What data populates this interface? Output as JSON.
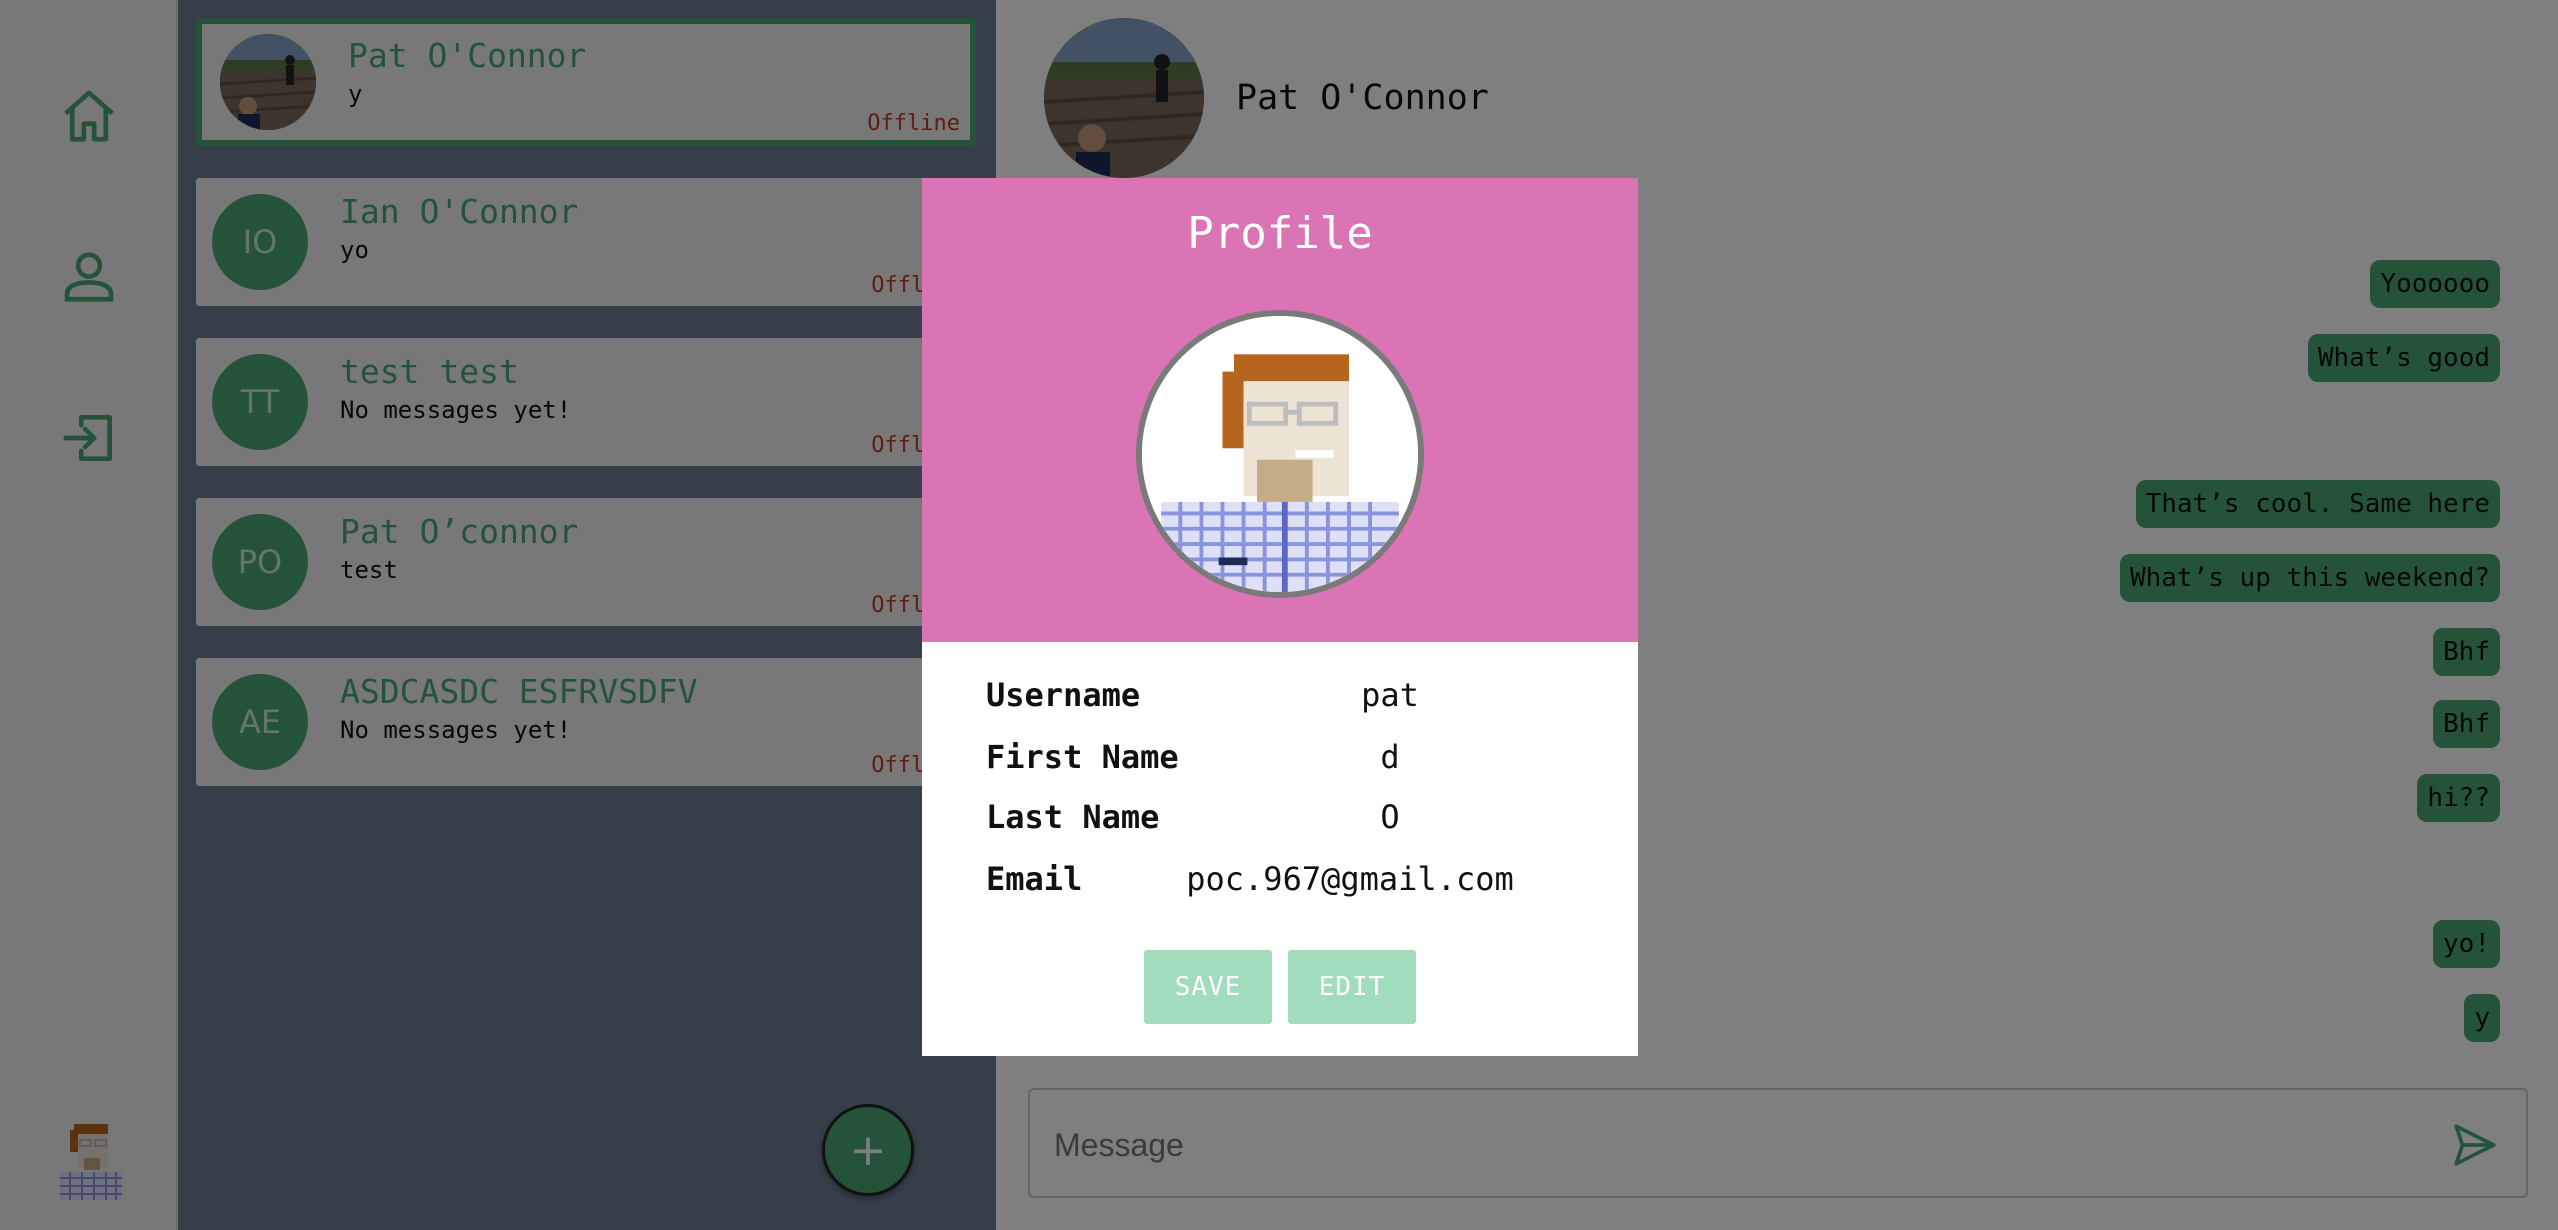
{
  "app": {
    "accent": "#4aa672",
    "panel_bg": "#6c7d92",
    "profile_header": "#db74b4"
  },
  "rail": {
    "items": [
      {
        "icon": "home-icon"
      },
      {
        "icon": "user-icon"
      },
      {
        "icon": "logout-icon"
      }
    ],
    "current_user_avatar": "pixel-avatar"
  },
  "conversations": [
    {
      "initials": "",
      "name": "Pat O'Connor",
      "last_message": "y",
      "status": "Offline",
      "active": true,
      "photo": true
    },
    {
      "initials": "IO",
      "name": "Ian O'Connor",
      "last_message": "yo",
      "status": "Offline"
    },
    {
      "initials": "TT",
      "name": "test test",
      "last_message": "No messages yet!",
      "status": "Offline"
    },
    {
      "initials": "PO",
      "name": "Pat O’connor",
      "last_message": "test",
      "status": "Offline"
    },
    {
      "initials": "AE",
      "name": "ASDCASDC ESFRVSDFV",
      "last_message": "No messages yet!",
      "status": "Offline"
    }
  ],
  "new_chat_button": {
    "label": "+"
  },
  "chat": {
    "title": "Pat O'Connor",
    "messages": [
      "Yoooooo",
      "What’s good",
      "That’s cool. Same here",
      "What’s up this weekend?",
      "Bhf",
      "Bhf",
      "hi??",
      "yo!",
      "y"
    ],
    "composer": {
      "placeholder": "Message",
      "value": ""
    }
  },
  "profile_modal": {
    "title": "Profile",
    "fields": [
      {
        "label": "Username",
        "value": "pat"
      },
      {
        "label": "First Name",
        "value": "d"
      },
      {
        "label": "Last Name",
        "value": "O"
      },
      {
        "label": "Email",
        "value": "poc.967@gmail.com"
      }
    ],
    "buttons": {
      "save": "SAVE",
      "edit": "EDIT"
    }
  }
}
